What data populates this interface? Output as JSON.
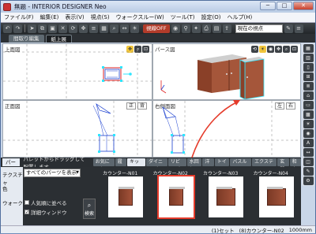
{
  "app": {
    "title": "無題 - INTERIOR DESIGNER Neo",
    "window_buttons": [
      "─",
      "□",
      "✕"
    ]
  },
  "menu": [
    "ファイル(F)",
    "編集(E)",
    "表示(V)",
    "視点(S)",
    "ウォークスルー(W)",
    "ツール(T)",
    "設定(O)",
    "ヘルプ(H)"
  ],
  "toolbar": {
    "badge": "視線OFF",
    "viewpoint_select": "現在の視点"
  },
  "tabs": [
    "間取り編集",
    "紙上展"
  ],
  "views": {
    "top_left": {
      "label": "上面図"
    },
    "top_right": {
      "label": "パース図"
    },
    "bottom_left": {
      "label": "正面図",
      "btn1": "正",
      "btn2": "背"
    },
    "bottom_right": {
      "label": "右側面図",
      "btn1": "左",
      "btn2": "右"
    }
  },
  "catbar": {
    "side_tab_1": "パーツ",
    "hint": "パレットからドラッグして配置します。",
    "categories": [
      "お気に入り",
      "履歴",
      "キッチン",
      "ダイニング",
      "リビング",
      "水回り",
      "洋風",
      "トイレ",
      "バスルーム",
      "エクステリア",
      "玄関",
      "和室"
    ],
    "active_category": "キッチン"
  },
  "panel": {
    "side_tabs": [
      "テクスチャ",
      "色",
      "ウォーク"
    ],
    "filter_value": "すべてのパーツを表示",
    "check1": "人気順に並べる",
    "check2": "詳細ウィンドウ",
    "detail_btn": "検索"
  },
  "parts": [
    {
      "label": "カウンター-N01"
    },
    {
      "label": "カウンター-N02",
      "selected": true
    },
    {
      "label": "カウンター-N03"
    },
    {
      "label": "カウンター-N04"
    }
  ],
  "status": {
    "set": "(1)セット",
    "item": "(8)カウンター-N02",
    "size": "1000mm"
  },
  "colors": {
    "accent_red": "#e53b2b",
    "cabinet_wood": "#a4533a",
    "select_cyan": "#2ee6ff"
  }
}
